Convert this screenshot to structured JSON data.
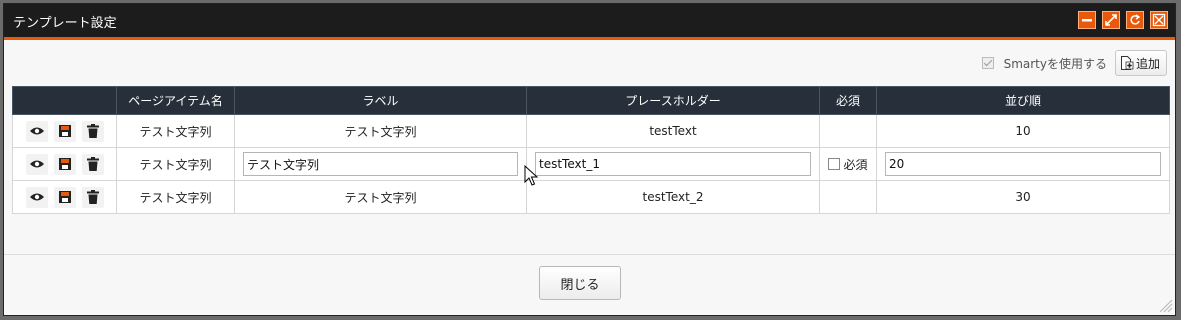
{
  "window": {
    "title": "テンプレート設定",
    "buttons": [
      "minimize-icon",
      "maximize-icon",
      "reload-icon",
      "close-icon"
    ]
  },
  "options": {
    "smarty_label": "Smartyを使用する",
    "smarty_checked": true,
    "add_label": "追加"
  },
  "table": {
    "headers": [
      "",
      "ページアイテム名",
      "ラベル",
      "プレースホルダー",
      "必須",
      "並び順"
    ],
    "rows": [
      {
        "name": "テスト文字列",
        "label": "テスト文字列",
        "placeholder": "testText",
        "required": "",
        "order": "10"
      },
      {
        "name": "テスト文字列",
        "label": "テスト文字列",
        "placeholder": "testText_1",
        "required": "必須",
        "order": "20"
      },
      {
        "name": "テスト文字列",
        "label": "テスト文字列",
        "placeholder": "testText_2",
        "required": "",
        "order": "30"
      }
    ]
  },
  "footer": {
    "close_label": "閉じる"
  },
  "colors": {
    "accent": "#e8590c",
    "header_bg": "#262f3a",
    "titlebar_bg": "#1c1c1c"
  }
}
